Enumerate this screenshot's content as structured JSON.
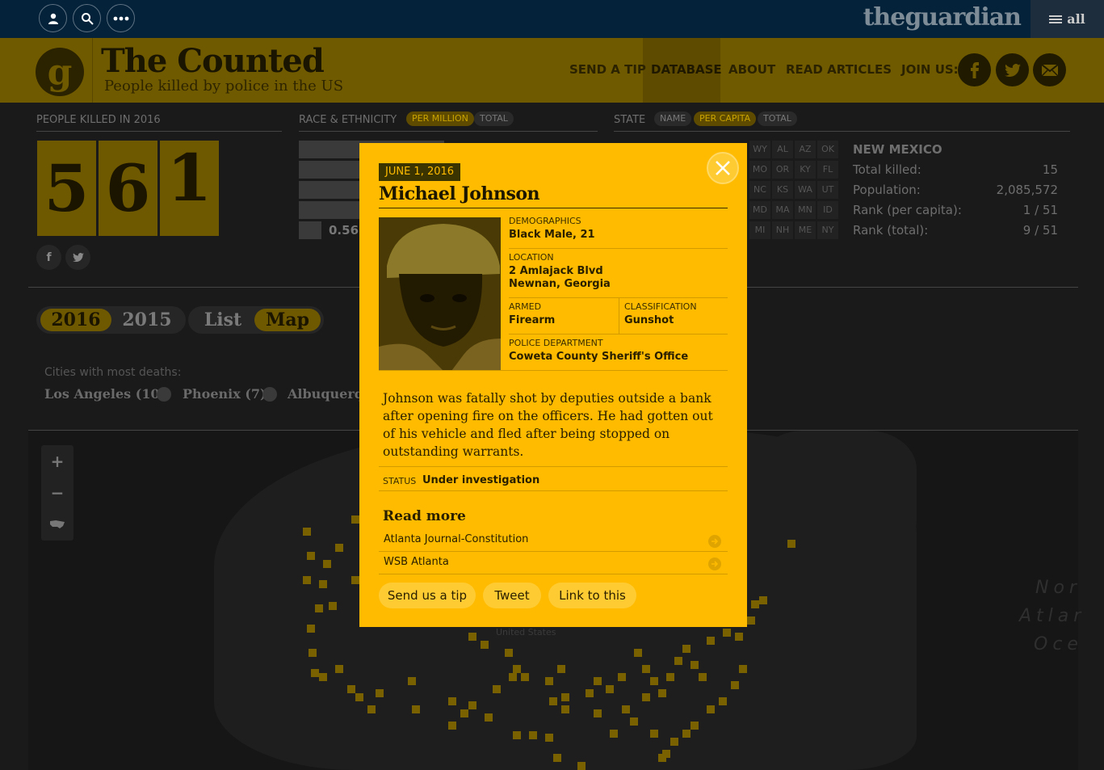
{
  "site": {
    "brand": "theguardian",
    "all_label": "all"
  },
  "header": {
    "logo_letter": "g",
    "title": "The Counted",
    "subtitle": "People killed by police in the US",
    "nav": [
      "SEND A TIP",
      "DATABASE",
      "ABOUT",
      "READ ARTICLES"
    ],
    "join_label": "JOIN US:"
  },
  "stats": {
    "killed_label": "PEOPLE KILLED IN 2016",
    "digits": [
      "5",
      "6",
      "1"
    ],
    "race_label": "RACE & ETHNICITY",
    "race_toggles": [
      "PER MILLION",
      "TOTAL"
    ],
    "race_value": "0.56",
    "state_label": "STATE",
    "state_toggles": [
      "NAME",
      "PER CAPITA",
      "TOTAL"
    ],
    "state_codes": [
      [
        "WY",
        "AL",
        "AZ",
        "OK"
      ],
      [
        "MO",
        "OR",
        "KY",
        "FL"
      ],
      [
        "NC",
        "KS",
        "WA",
        "UT"
      ],
      [
        "MD",
        "MA",
        "MN",
        "ID"
      ],
      [
        "MI",
        "NH",
        "ME",
        "NY"
      ]
    ],
    "state_info": {
      "name": "NEW MEXICO",
      "rows": [
        {
          "label": "Total killed:",
          "value": "15"
        },
        {
          "label": "Population:",
          "value": "2,085,572"
        },
        {
          "label": "Rank (per capita):",
          "value": "1 / 51"
        },
        {
          "label": "Rank (total):",
          "value": "9 / 51"
        }
      ]
    }
  },
  "controls": {
    "years": [
      "2016",
      "2015"
    ],
    "views": [
      "List",
      "Map"
    ],
    "cities_label": "Cities with most deaths:",
    "cities": [
      "Los Angeles (10)",
      "Phoenix (7)",
      "Albuquerq"
    ]
  },
  "map": {
    "country_label": "United States",
    "ocean_lines": [
      "Nor",
      "Atlar",
      "Oce"
    ]
  },
  "modal": {
    "date": "JUNE 1, 2016",
    "name": "Michael Johnson",
    "demographics_label": "DEMOGRAPHICS",
    "demographics": "Black Male, 21",
    "location_label": "LOCATION",
    "location_line1": "2 Amlajack Blvd",
    "location_line2": "Newnan, Georgia",
    "armed_label": "ARMED",
    "armed": "Firearm",
    "classification_label": "CLASSIFICATION",
    "classification": "Gunshot",
    "department_label": "POLICE DEPARTMENT",
    "department": "Coweta County Sheriff's Office",
    "description": "Johnson was fatally shot by deputies outside a bank after opening fire on the officers. He had gotten out of his vehicle and fled after being stopped on outstanding warrants.",
    "status_label": "STATUS",
    "status": "Under investigation",
    "read_more": "Read more",
    "links": [
      "Atlanta Journal-Constitution",
      "WSB Atlanta"
    ],
    "actions": [
      "Send us a tip",
      "Tweet",
      "Link to this"
    ]
  }
}
